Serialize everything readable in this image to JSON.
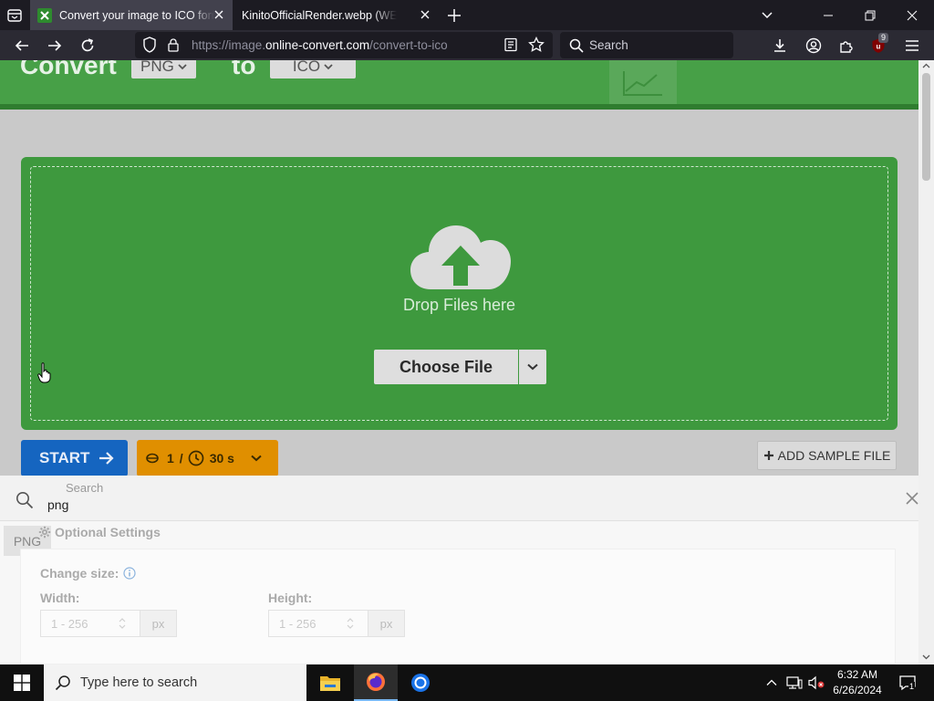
{
  "browser": {
    "tabs": [
      {
        "title": "Convert your image to ICO format",
        "active": true
      },
      {
        "title": "KinitoOfficialRender.webp (WEBP Image)",
        "active": false
      }
    ],
    "url_prefix": "https://image.",
    "url_domain": "online-convert.com",
    "url_path": "/convert-to-ico",
    "search_placeholder": "Search",
    "extension_badge": "9"
  },
  "hero": {
    "title": "Convert",
    "from_format": "PNG",
    "to_word": "to",
    "to_format": "ICO"
  },
  "upload": {
    "drop_text": "Drop Files here",
    "choose_file_label": "Choose File"
  },
  "actions": {
    "start_label": "START",
    "credits_count": "1",
    "credits_separator": "/",
    "time_label": "30 s",
    "add_sample_label": "ADD SAMPLE FILE"
  },
  "find_bar": {
    "label": "Search",
    "value": "png"
  },
  "options": {
    "section_title": "Optional Settings",
    "chip_label": "PNG",
    "change_size_label": "Change size:",
    "width_label": "Width:",
    "height_label": "Height:",
    "width_placeholder": "1 - 256",
    "height_placeholder": "1 - 256",
    "unit": "px"
  },
  "taskbar": {
    "search_placeholder": "Type here to search",
    "time": "6:32 AM",
    "date": "6/26/2024",
    "notification_count": "1"
  },
  "colors": {
    "hero_green": "#47a047",
    "drop_green": "#3e993e",
    "start_blue": "#1565c0",
    "credits_orange": "#e08f00"
  }
}
